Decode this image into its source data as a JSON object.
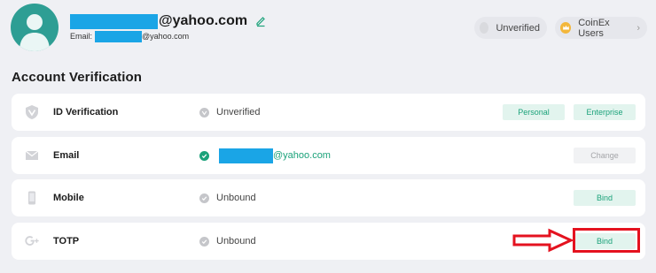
{
  "header": {
    "email_domain": "@yahoo.com",
    "email_label": "Email:",
    "email_sub_domain": "@yahoo.com",
    "unverified_badge": "Unverified",
    "users_badge": "CoinEx Users",
    "users_chevron": "›"
  },
  "section": {
    "title": "Account Verification"
  },
  "rows": {
    "id": {
      "label": "ID Verification",
      "status": "Unverified",
      "btn_personal": "Personal",
      "btn_enterprise": "Enterprise"
    },
    "email": {
      "label": "Email",
      "status_domain": "@yahoo.com",
      "btn_change": "Change"
    },
    "mobile": {
      "label": "Mobile",
      "status": "Unbound",
      "btn_bind": "Bind"
    },
    "totp": {
      "label": "TOTP",
      "status": "Unbound",
      "btn_bind": "Bind"
    }
  },
  "colors": {
    "accent_green": "#1ba27a",
    "redaction_blue": "#1aa5e6",
    "annotation_red": "#e4121f"
  },
  "icons": [
    "avatar",
    "edit-icon",
    "unverified-dot-icon",
    "crown-icon",
    "id-shield-icon",
    "mail-icon",
    "phone-icon",
    "google-plus-icon",
    "check-icon"
  ]
}
